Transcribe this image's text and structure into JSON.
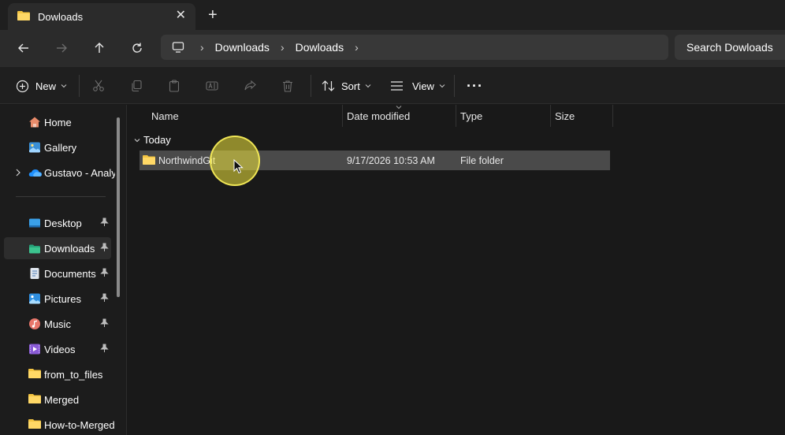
{
  "tab": {
    "title": "Dowloads",
    "close": "✕",
    "new": "+"
  },
  "address": {
    "crumbs": [
      "Downloads",
      "Dowloads"
    ],
    "search_placeholder": "Search Dowloads"
  },
  "commands": {
    "new_label": "New",
    "sort_label": "Sort",
    "view_label": "View",
    "more_label": "···"
  },
  "sidebar": {
    "items": [
      {
        "label": "Home",
        "icon": "home-icon"
      },
      {
        "label": "Gallery",
        "icon": "gallery-icon"
      },
      {
        "label": "Gustavo - Analyt",
        "icon": "onedrive-icon"
      },
      {
        "label": "Desktop",
        "icon": "desktop-icon",
        "pinned": true
      },
      {
        "label": "Downloads",
        "icon": "downloads-icon",
        "pinned": true,
        "selected": true
      },
      {
        "label": "Documents",
        "icon": "documents-icon",
        "pinned": true
      },
      {
        "label": "Pictures",
        "icon": "pictures-icon",
        "pinned": true
      },
      {
        "label": "Music",
        "icon": "music-icon",
        "pinned": true
      },
      {
        "label": "Videos",
        "icon": "videos-icon",
        "pinned": true
      },
      {
        "label": "from_to_files",
        "icon": "folder-icon"
      },
      {
        "label": "Merged",
        "icon": "folder-icon"
      },
      {
        "label": "How-to-Merged",
        "icon": "folder-icon"
      }
    ]
  },
  "columns": {
    "name": "Name",
    "date": "Date modified",
    "type": "Type",
    "size": "Size"
  },
  "group": {
    "label": "Today"
  },
  "files": [
    {
      "name": "NorthwindGit",
      "date": "9/17/2026 10:53 AM",
      "type": "File folder",
      "size": ""
    }
  ],
  "colors": {
    "folder": "#f4c542",
    "accent": "#4cc2ff",
    "selected_row": "#4a4a4a"
  }
}
